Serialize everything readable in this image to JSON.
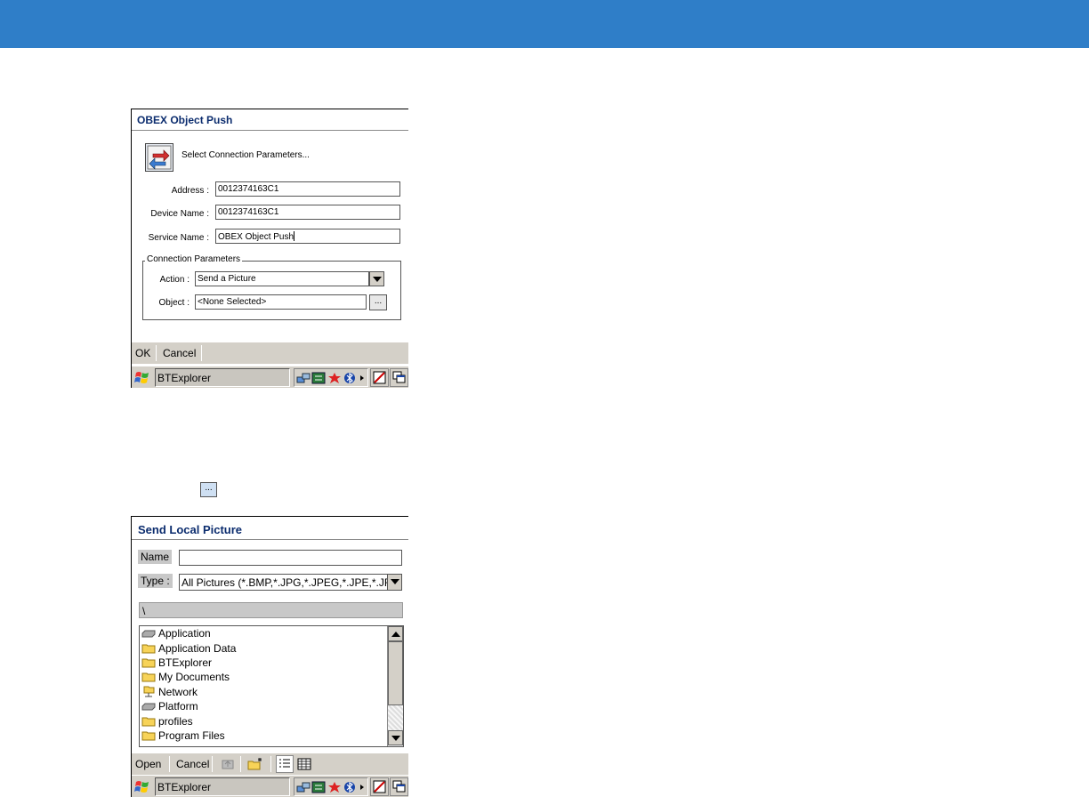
{
  "colors": {
    "accent_band": "#2f7ec8",
    "title_text": "#0b2c6e",
    "chrome": "#d4d0c8"
  },
  "obex_dialog": {
    "title": "OBEX Object Push",
    "prompt": "Select Connection Parameters...",
    "fields": [
      {
        "label": "Address :",
        "value": "0012374163C1"
      },
      {
        "label": "Device Name :",
        "value": "0012374163C1"
      },
      {
        "label": "Service Name :",
        "value": "OBEX Object Push"
      }
    ],
    "group": {
      "legend": "Connection Parameters",
      "action_label": "Action :",
      "action_value": "Send a Picture",
      "object_label": "Object :",
      "object_value": "<None Selected>",
      "browse_label": "..."
    },
    "commands": {
      "ok": "OK",
      "cancel": "Cancel"
    }
  },
  "taskbar": {
    "app_label": "BTExplorer",
    "icons": [
      "start-windows-icon",
      "network-icon",
      "sync-icon",
      "star-icon",
      "bluetooth-icon",
      "tray-expand-icon",
      "input-panel-icon",
      "switch-windows-icon"
    ]
  },
  "standalone_browse_button": {
    "label": "..."
  },
  "send_picture_dialog": {
    "title": "Send Local Picture",
    "name_label": "Name",
    "name_value": "",
    "type_label": "Type :",
    "type_value": "All Pictures (*.BMP,*.JPG,*.JPEG,*.JPE,*.JF",
    "path": "\\",
    "items": [
      {
        "label": "Application",
        "icon": "drive-icon"
      },
      {
        "label": "Application Data",
        "icon": "folder-icon"
      },
      {
        "label": "BTExplorer",
        "icon": "folder-icon"
      },
      {
        "label": "My Documents",
        "icon": "folder-icon"
      },
      {
        "label": "Network",
        "icon": "network-folder-icon"
      },
      {
        "label": "Platform",
        "icon": "drive-icon"
      },
      {
        "label": "profiles",
        "icon": "folder-icon"
      },
      {
        "label": "Program Files",
        "icon": "folder-icon"
      }
    ],
    "commands": {
      "open": "Open",
      "cancel": "Cancel"
    },
    "toolbar_icons": [
      "up-folder-icon",
      "new-folder-icon",
      "list-view-icon",
      "details-view-icon"
    ]
  }
}
